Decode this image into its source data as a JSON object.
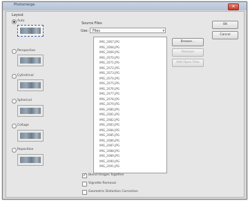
{
  "window": {
    "title": "Photomerge",
    "close_glyph": "✕"
  },
  "layout": {
    "group_label": "Layout",
    "options": [
      {
        "label": "Auto",
        "selected": true,
        "icon": "layout-auto-icon"
      },
      {
        "label": "Perspective",
        "selected": false,
        "icon": "layout-perspective-icon"
      },
      {
        "label": "Cylindrical",
        "selected": false,
        "icon": "layout-cylindrical-icon"
      },
      {
        "label": "Spherical",
        "selected": false,
        "icon": "layout-spherical-icon"
      },
      {
        "label": "Collage",
        "selected": false,
        "icon": "layout-collage-icon"
      },
      {
        "label": "Reposition",
        "selected": false,
        "icon": "layout-reposition-icon"
      }
    ]
  },
  "source": {
    "group_label": "Source Files",
    "use_label": "Use:",
    "use_value": "Files",
    "files": [
      "IMG_2067.JPG",
      "IMG_2068.JPG",
      "IMG_2069.JPG",
      "IMG_2070.JPG",
      "IMG_2071.JPG",
      "IMG_2072.JPG",
      "IMG_2073.JPG",
      "IMG_2074.JPG",
      "IMG_2075.JPG",
      "IMG_2076.JPG",
      "IMG_2077.JPG",
      "IMG_2078.JPG",
      "IMG_2079.JPG",
      "IMG_2080.JPG",
      "IMG_2081.JPG",
      "IMG_2082.JPG",
      "IMG_2083.JPG",
      "IMG_2084.JPG",
      "IMG_2085.JPG",
      "IMG_2086.JPG",
      "IMG_2087.JPG",
      "IMG_2088.JPG",
      "IMG_2089.JPG",
      "IMG_2090.JPG",
      "IMG_2091.JPG"
    ],
    "buttons": {
      "browse": "Browse...",
      "remove": "Remove",
      "add_open": "Add Open Files"
    }
  },
  "options": {
    "blend": {
      "label": "Blend Images Together",
      "checked": true
    },
    "vignette": {
      "label": "Vignette Removal",
      "checked": false
    },
    "distortion": {
      "label": "Geometric Distortion Correction",
      "checked": false
    }
  },
  "actions": {
    "ok": "OK",
    "cancel": "Cancel"
  }
}
